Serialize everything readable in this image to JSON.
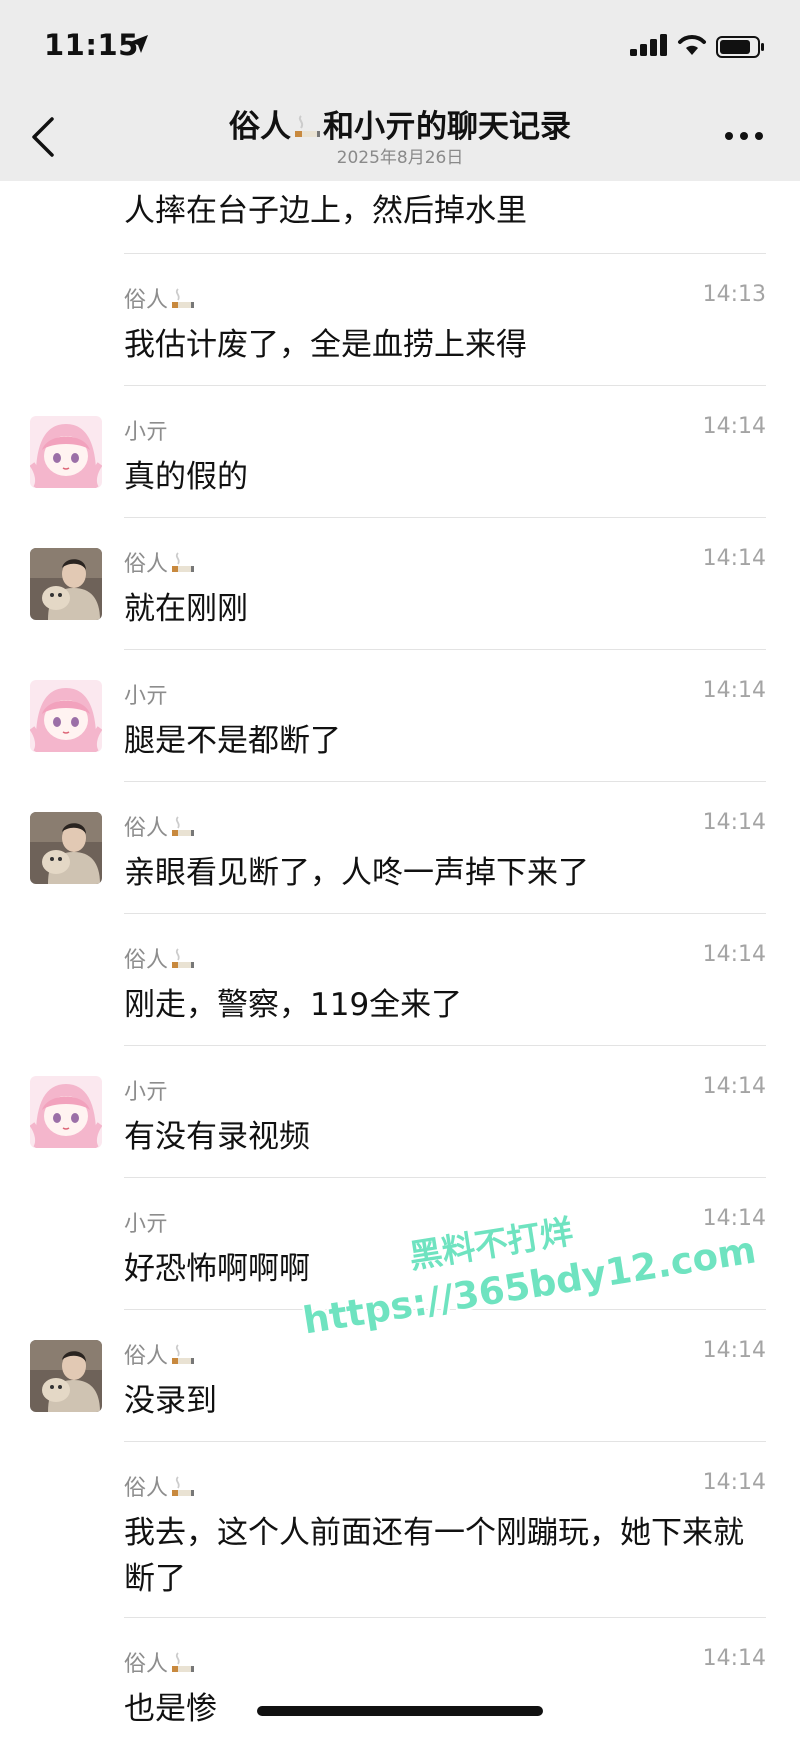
{
  "status_bar": {
    "time": "11:15"
  },
  "header": {
    "title_left": "俗人",
    "title_right": "和小亓的聊天记录",
    "date": "2025年8月26日"
  },
  "first_line": "人摔在台子边上，然后掉水里",
  "messages": [
    {
      "sender": "俗人",
      "time": "14:13",
      "text": "我估计废了，全是血捞上来得",
      "avatar": "none"
    },
    {
      "sender": "小亓",
      "time": "14:14",
      "text": "真的假的",
      "avatar": "anime"
    },
    {
      "sender": "俗人",
      "time": "14:14",
      "text": "就在刚刚",
      "avatar": "photo"
    },
    {
      "sender": "小亓",
      "time": "14:14",
      "text": "腿是不是都断了",
      "avatar": "anime"
    },
    {
      "sender": "俗人",
      "time": "14:14",
      "text": "亲眼看见断了，人咚一声掉下来了",
      "avatar": "photo"
    },
    {
      "sender": "俗人",
      "time": "14:14",
      "text": "刚走，警察，119全来了",
      "avatar": "none"
    },
    {
      "sender": "小亓",
      "time": "14:14",
      "text": "有没有录视频",
      "avatar": "anime"
    },
    {
      "sender": "小亓",
      "time": "14:14",
      "text": "好恐怖啊啊啊",
      "avatar": "none"
    },
    {
      "sender": "俗人",
      "time": "14:14",
      "text": "没录到",
      "avatar": "photo"
    },
    {
      "sender": "俗人",
      "time": "14:14",
      "text": "我去，这个人前面还有一个刚蹦玩，她下来就断了",
      "avatar": "none"
    },
    {
      "sender": "俗人",
      "time": "14:14",
      "text": "也是惨",
      "avatar": "none"
    }
  ],
  "watermark": {
    "line1": "黑料不打烊",
    "line2": "https://365bdy12.com"
  }
}
